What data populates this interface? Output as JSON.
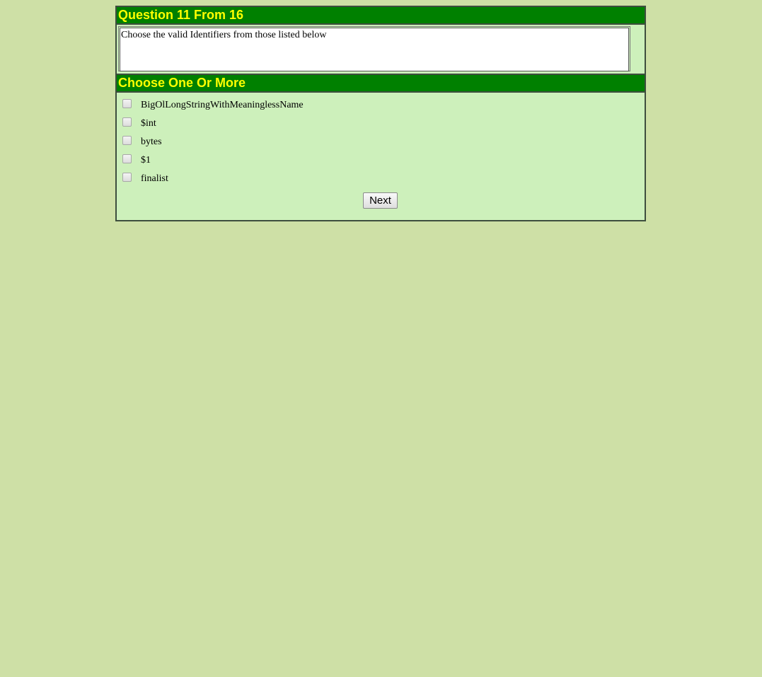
{
  "quiz": {
    "question_header": "Question 11 From 16",
    "question_text": "Choose the valid Identifiers from those listed below",
    "choose_header": "Choose One Or More",
    "options": [
      "BigOlLongStringWithMeaninglessName",
      "$int",
      "bytes",
      "$1",
      "finalist"
    ],
    "next_label": "Next"
  },
  "colors": {
    "page_background": "#cee0a6",
    "panel_background": "#cdf0bb",
    "header_background": "#008000",
    "header_text": "#ffff00"
  }
}
